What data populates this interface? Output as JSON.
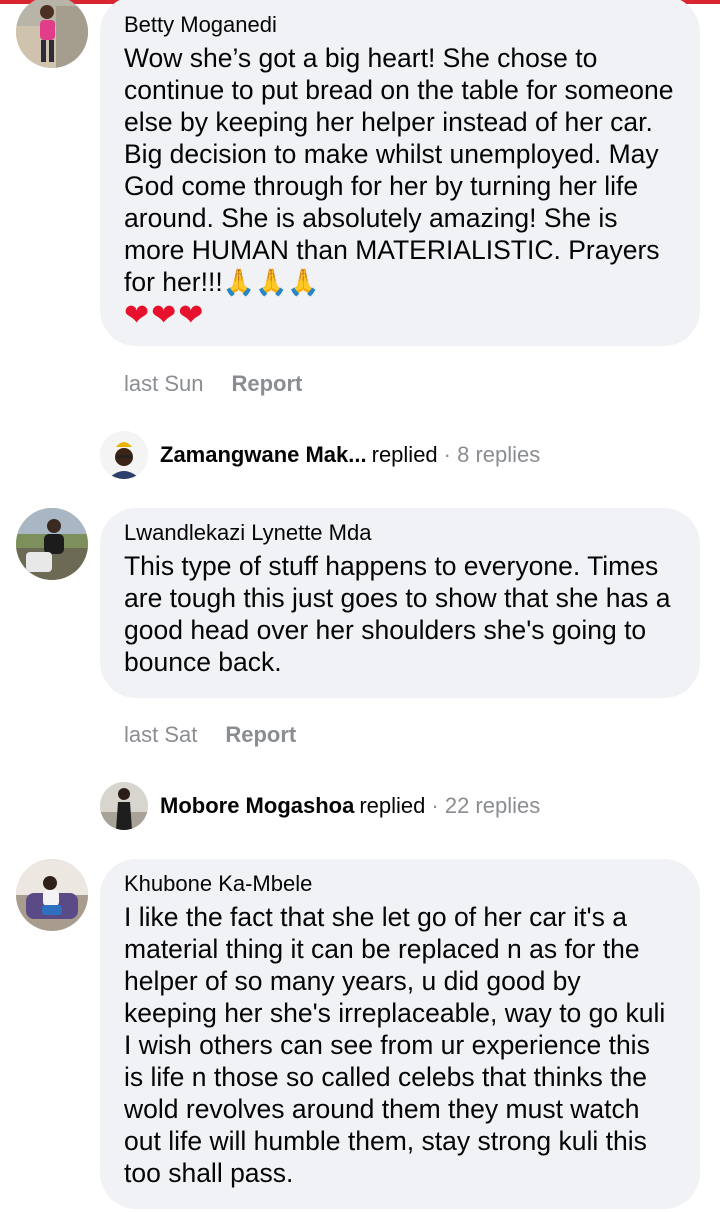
{
  "comments": [
    {
      "author": "Betty Moganedi",
      "text": "Wow she’s got a big heart! She chose to continue to put bread on the table for someone else by keeping her helper instead of her car. Big decision to make whilst unemployed. May God come through for her by turning her life around. She is absolutely amazing! She is more HUMAN than MATERIALISTIC. Prayers for her!!!",
      "emoji_prayers": "🙏🙏🙏",
      "emoji_hearts": "❤❤❤",
      "time": "last Sun",
      "report_label": "Report",
      "reply": {
        "name": "Zamangwane Mak...",
        "verb": "replied",
        "count": "· 8 replies"
      }
    },
    {
      "author": "Lwandlekazi Lynette Mda",
      "text": "This type of stuff happens to everyone. Times are tough this just goes to show that she has a good head over her shoulders she's going to bounce back.",
      "time": "last Sat",
      "report_label": "Report",
      "reply": {
        "name": "Mobore Mogashoa",
        "verb": "replied",
        "count": "· 22 replies"
      }
    },
    {
      "author": "Khubone Ka-Mbele",
      "text": "I like the fact that she let go of her car it's a material thing it can be replaced n as for the helper of so many years, u did good by keeping her she's irreplaceable, way to go kuli I wish others can see from ur experience this is life n those so called celebs that thinks the wold revolves around them they must watch out life will humble them, stay strong kuli this too shall pass."
    }
  ],
  "colors": {
    "top_bar": "#d9252f",
    "bubble_bg": "#f0f2f5",
    "secondary_text": "#8a8d91",
    "heart": "#e8112d"
  }
}
